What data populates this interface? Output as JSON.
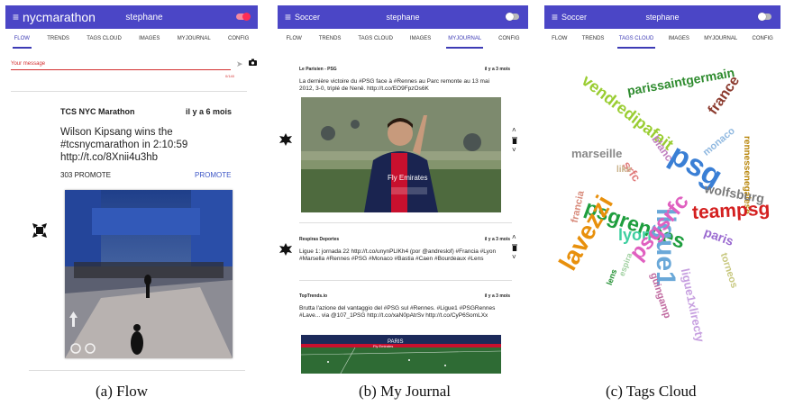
{
  "panels": [
    {
      "appbar": {
        "title": "nycmarathon",
        "user": "stephane",
        "toggle": "on"
      },
      "tabs": [
        "FLOW",
        "TRENDS",
        "TAGS CLOUD",
        "IMAGES",
        "MYJOURNAL",
        "CONFIG"
      ],
      "active_tab": "FLOW",
      "caption": "(a) Flow"
    },
    {
      "appbar": {
        "title": "Soccer",
        "user": "stephane",
        "toggle": "off"
      },
      "tabs": [
        "FLOW",
        "TRENDS",
        "TAGS CLOUD",
        "IMAGES",
        "MYJOURNAL",
        "CONFIG"
      ],
      "active_tab": "MYJOURNAL",
      "caption": "(b) My Journal"
    },
    {
      "appbar": {
        "title": "Soccer",
        "user": "stephane",
        "toggle": "off"
      },
      "tabs": [
        "FLOW",
        "TRENDS",
        "TAGS CLOUD",
        "IMAGES",
        "MYJOURNAL",
        "CONFIG"
      ],
      "active_tab": "TAGS CLOUD",
      "caption": "(c) Tags Cloud"
    }
  ],
  "flow": {
    "composer": {
      "label": "Your message",
      "counter": "0/140"
    },
    "post": {
      "author": "TCS NYC Marathon",
      "time": "il y a 6 mois",
      "text": "Wilson Kipsang wins the #tcsnycmarathon in 2:10:59 http://t.co/8Xnii4u3hb",
      "promote_count": "303 PROMOTE",
      "promote_label": "PROMOTE"
    }
  },
  "journal": {
    "posts": [
      {
        "author": "Le Parisien - PSG",
        "time": "il y a 3 mois",
        "text": "La dernière victoire du #PSG face à #Rennes au Parc remonte au 13 mai 2012, 3-0, triplé de Nenê. http://t.co/EO9FpzOs6K"
      },
      {
        "author": "Respiras Deportes",
        "time": "il y a 3 mois",
        "text": "Ligue 1: jornada 22 http://t.co/unynPLlKh4 (por @andreslof) #Francia #Lyon #Marsella #Rennes #PSG #Monaco #Bastia #Caen #Bourdeaux #Lens"
      },
      {
        "author": "TopTrends.io",
        "time": "il y a 3 mois",
        "text": "Brutta l'azione del vantaggio del #PSG sul #Rennes. #Ligue1 #PSGRennes #Lave... via @107_1PSG http://t.co/xaN0pAtrSv http://t.co/CyP6SomLXx"
      }
    ],
    "stadium_banner": "PARIS",
    "stadium_ad": "Fly Emirates"
  },
  "tag_cloud": {
    "words": [
      {
        "text": "parissaintgermain",
        "color": "#2e8b2e"
      },
      {
        "text": "vendredipafait",
        "color": "#9acd32"
      },
      {
        "text": "france",
        "color": "#8b3a2e"
      },
      {
        "text": "rennessenegalese",
        "color": "#b8860b"
      },
      {
        "text": "psg",
        "color": "#3a7fd5"
      },
      {
        "text": "marseille",
        "color": "#888888"
      },
      {
        "text": "srfc",
        "color": "#e07a7a"
      },
      {
        "text": "blanc",
        "color": "#c080c0"
      },
      {
        "text": "monaco",
        "color": "#8fb8e0"
      },
      {
        "text": "like",
        "color": "#c9b28a"
      },
      {
        "text": "psgrennes",
        "color": "#1e9e3e"
      },
      {
        "text": "ligue1",
        "color": "#6aa8d8"
      },
      {
        "text": "wolfsburg",
        "color": "#7a7a7a"
      },
      {
        "text": "teampsg",
        "color": "#d42020"
      },
      {
        "text": "francia",
        "color": "#d88a7a"
      },
      {
        "text": "lavezzi",
        "color": "#e8900c"
      },
      {
        "text": "lyon",
        "color": "#3ecfa0"
      },
      {
        "text": "paris",
        "color": "#9a6ad0"
      },
      {
        "text": "ligue1xlirecty",
        "color": "#c7a0e0"
      },
      {
        "text": "psgsrfc",
        "color": "#e060c0"
      },
      {
        "text": "guingamp",
        "color": "#c06aa0"
      },
      {
        "text": "lens",
        "color": "#1e8e2e"
      },
      {
        "text": "espira",
        "color": "#a0d0a0"
      },
      {
        "text": "torneos",
        "color": "#c8c880"
      }
    ]
  }
}
